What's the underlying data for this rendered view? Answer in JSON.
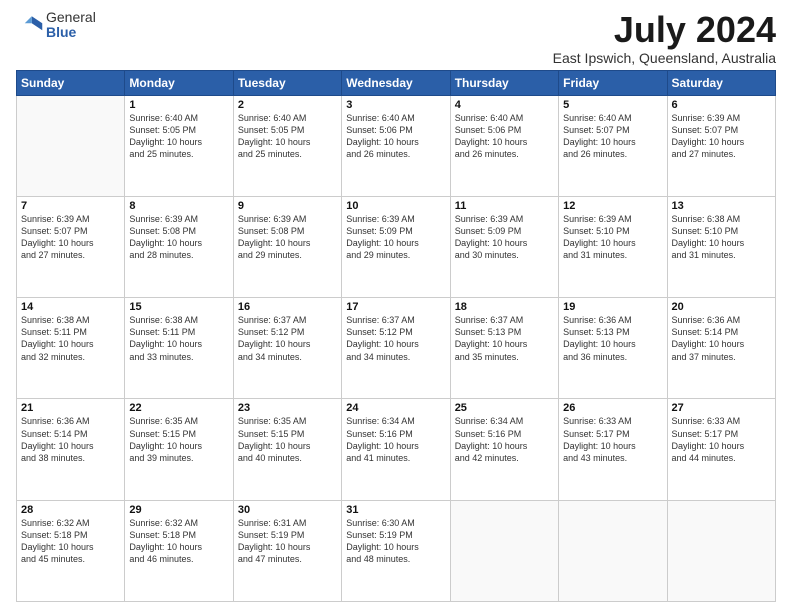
{
  "header": {
    "logo_general": "General",
    "logo_blue": "Blue",
    "main_title": "July 2024",
    "subtitle": "East Ipswich, Queensland, Australia"
  },
  "calendar": {
    "days_of_week": [
      "Sunday",
      "Monday",
      "Tuesday",
      "Wednesday",
      "Thursday",
      "Friday",
      "Saturday"
    ],
    "weeks": [
      [
        {
          "day": "",
          "info": ""
        },
        {
          "day": "1",
          "info": "Sunrise: 6:40 AM\nSunset: 5:05 PM\nDaylight: 10 hours\nand 25 minutes."
        },
        {
          "day": "2",
          "info": "Sunrise: 6:40 AM\nSunset: 5:05 PM\nDaylight: 10 hours\nand 25 minutes."
        },
        {
          "day": "3",
          "info": "Sunrise: 6:40 AM\nSunset: 5:06 PM\nDaylight: 10 hours\nand 26 minutes."
        },
        {
          "day": "4",
          "info": "Sunrise: 6:40 AM\nSunset: 5:06 PM\nDaylight: 10 hours\nand 26 minutes."
        },
        {
          "day": "5",
          "info": "Sunrise: 6:40 AM\nSunset: 5:07 PM\nDaylight: 10 hours\nand 26 minutes."
        },
        {
          "day": "6",
          "info": "Sunrise: 6:39 AM\nSunset: 5:07 PM\nDaylight: 10 hours\nand 27 minutes."
        }
      ],
      [
        {
          "day": "7",
          "info": "Sunrise: 6:39 AM\nSunset: 5:07 PM\nDaylight: 10 hours\nand 27 minutes."
        },
        {
          "day": "8",
          "info": "Sunrise: 6:39 AM\nSunset: 5:08 PM\nDaylight: 10 hours\nand 28 minutes."
        },
        {
          "day": "9",
          "info": "Sunrise: 6:39 AM\nSunset: 5:08 PM\nDaylight: 10 hours\nand 29 minutes."
        },
        {
          "day": "10",
          "info": "Sunrise: 6:39 AM\nSunset: 5:09 PM\nDaylight: 10 hours\nand 29 minutes."
        },
        {
          "day": "11",
          "info": "Sunrise: 6:39 AM\nSunset: 5:09 PM\nDaylight: 10 hours\nand 30 minutes."
        },
        {
          "day": "12",
          "info": "Sunrise: 6:39 AM\nSunset: 5:10 PM\nDaylight: 10 hours\nand 31 minutes."
        },
        {
          "day": "13",
          "info": "Sunrise: 6:38 AM\nSunset: 5:10 PM\nDaylight: 10 hours\nand 31 minutes."
        }
      ],
      [
        {
          "day": "14",
          "info": "Sunrise: 6:38 AM\nSunset: 5:11 PM\nDaylight: 10 hours\nand 32 minutes."
        },
        {
          "day": "15",
          "info": "Sunrise: 6:38 AM\nSunset: 5:11 PM\nDaylight: 10 hours\nand 33 minutes."
        },
        {
          "day": "16",
          "info": "Sunrise: 6:37 AM\nSunset: 5:12 PM\nDaylight: 10 hours\nand 34 minutes."
        },
        {
          "day": "17",
          "info": "Sunrise: 6:37 AM\nSunset: 5:12 PM\nDaylight: 10 hours\nand 34 minutes."
        },
        {
          "day": "18",
          "info": "Sunrise: 6:37 AM\nSunset: 5:13 PM\nDaylight: 10 hours\nand 35 minutes."
        },
        {
          "day": "19",
          "info": "Sunrise: 6:36 AM\nSunset: 5:13 PM\nDaylight: 10 hours\nand 36 minutes."
        },
        {
          "day": "20",
          "info": "Sunrise: 6:36 AM\nSunset: 5:14 PM\nDaylight: 10 hours\nand 37 minutes."
        }
      ],
      [
        {
          "day": "21",
          "info": "Sunrise: 6:36 AM\nSunset: 5:14 PM\nDaylight: 10 hours\nand 38 minutes."
        },
        {
          "day": "22",
          "info": "Sunrise: 6:35 AM\nSunset: 5:15 PM\nDaylight: 10 hours\nand 39 minutes."
        },
        {
          "day": "23",
          "info": "Sunrise: 6:35 AM\nSunset: 5:15 PM\nDaylight: 10 hours\nand 40 minutes."
        },
        {
          "day": "24",
          "info": "Sunrise: 6:34 AM\nSunset: 5:16 PM\nDaylight: 10 hours\nand 41 minutes."
        },
        {
          "day": "25",
          "info": "Sunrise: 6:34 AM\nSunset: 5:16 PM\nDaylight: 10 hours\nand 42 minutes."
        },
        {
          "day": "26",
          "info": "Sunrise: 6:33 AM\nSunset: 5:17 PM\nDaylight: 10 hours\nand 43 minutes."
        },
        {
          "day": "27",
          "info": "Sunrise: 6:33 AM\nSunset: 5:17 PM\nDaylight: 10 hours\nand 44 minutes."
        }
      ],
      [
        {
          "day": "28",
          "info": "Sunrise: 6:32 AM\nSunset: 5:18 PM\nDaylight: 10 hours\nand 45 minutes."
        },
        {
          "day": "29",
          "info": "Sunrise: 6:32 AM\nSunset: 5:18 PM\nDaylight: 10 hours\nand 46 minutes."
        },
        {
          "day": "30",
          "info": "Sunrise: 6:31 AM\nSunset: 5:19 PM\nDaylight: 10 hours\nand 47 minutes."
        },
        {
          "day": "31",
          "info": "Sunrise: 6:30 AM\nSunset: 5:19 PM\nDaylight: 10 hours\nand 48 minutes."
        },
        {
          "day": "",
          "info": ""
        },
        {
          "day": "",
          "info": ""
        },
        {
          "day": "",
          "info": ""
        }
      ]
    ]
  }
}
